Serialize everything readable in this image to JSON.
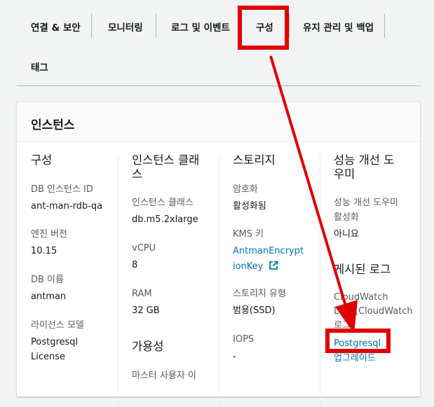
{
  "tabs": [
    {
      "label": "연결 & 보안"
    },
    {
      "label": "모니터링"
    },
    {
      "label": "로그 및 이벤트"
    },
    {
      "label": "구성"
    },
    {
      "label": "유지 관리 및 백업"
    },
    {
      "label": "태그"
    }
  ],
  "panel": {
    "title": "인스턴스",
    "col1": {
      "title": "구성",
      "fields": [
        {
          "label": "DB 인스턴스 ID",
          "value": "ant-man-rdb-qa"
        },
        {
          "label": "엔진 버전",
          "value": "10.15"
        },
        {
          "label": "DB 이름",
          "value": "antman"
        },
        {
          "label": "라이선스 모델",
          "value_line1": "Postgresql",
          "value_line2": "License"
        }
      ]
    },
    "col2": {
      "title_line1": "인스턴스 클래",
      "title_line2": "스",
      "fields": [
        {
          "label": "인스턴스 클래스",
          "value": "db.m5.2xlarge"
        },
        {
          "label": "vCPU",
          "value": "8"
        },
        {
          "label": "RAM",
          "value": "32 GB"
        }
      ],
      "availability_title": "가용성",
      "master_user_label": "마스터 사용자 이"
    },
    "col3": {
      "title": "스토리지",
      "encryption_label": "암호화",
      "encryption_value": "활성화됨",
      "kms_label": "KMS 키",
      "kms_link_line1": "AntmanEncrypt",
      "kms_link_line2": "ionKey",
      "storage_type_label": "스토리지 유형",
      "storage_type_value": "범용(SSD)",
      "iops_label": "IOPS",
      "iops_value": "-"
    },
    "col4": {
      "title_line1": "성능 개선 도",
      "title_line2": "우미",
      "pi_label_line1": "성능 개선 도우미",
      "pi_label_line2": "활성화",
      "pi_value": "아니요",
      "logs_title": "게시된 로그",
      "logs_label_line1": "CloudWatch",
      "logs_label_line2": "Logs(CloudWatch",
      "logs_label_line3": "로그)",
      "logs_link": "Postgresql",
      "upgrade_link": "업그레이드"
    }
  },
  "colors": {
    "highlight": "#e00000",
    "link": "#0073bb"
  }
}
